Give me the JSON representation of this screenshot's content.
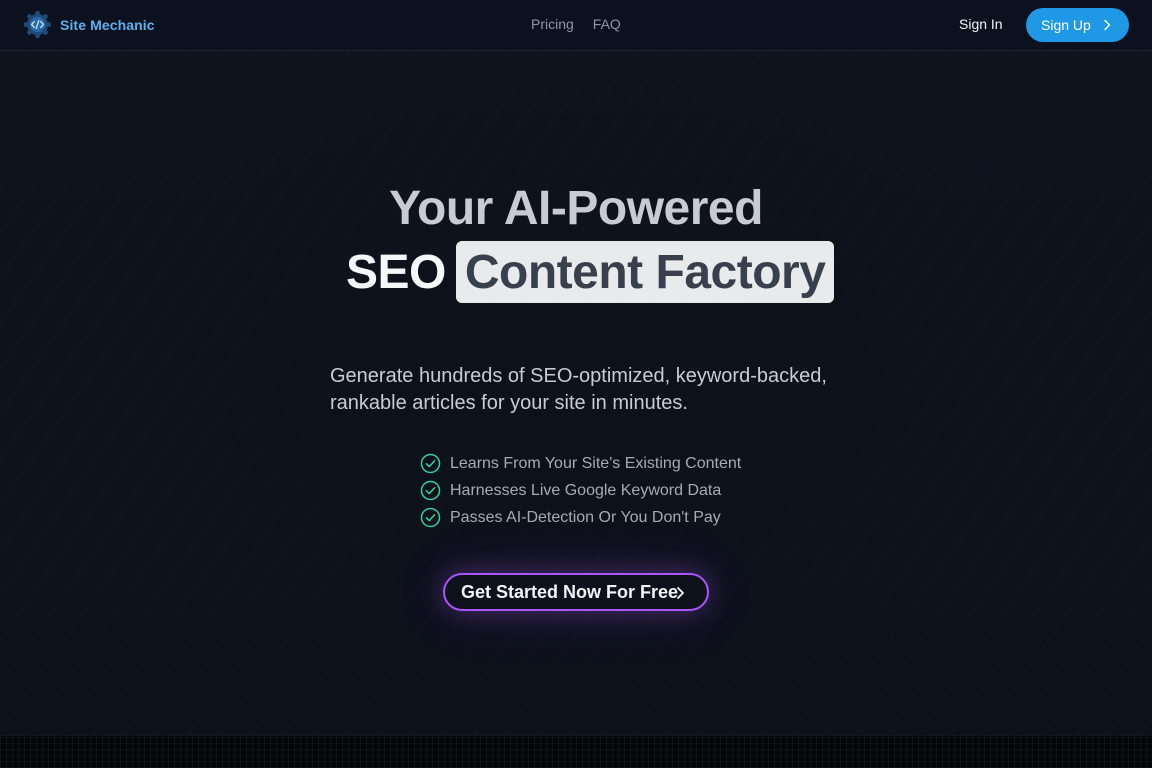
{
  "header": {
    "brand": "Site Mechanic",
    "nav": [
      "Pricing",
      "FAQ"
    ],
    "sign_in": "Sign In",
    "sign_up": "Sign Up"
  },
  "hero": {
    "title_line1": "Your AI-Powered",
    "title_line2_plain": "SEO",
    "title_line2_highlight": "Content Factory",
    "subtitle": "Generate hundreds of SEO-optimized, keyword-backed, rankable articles for your site in minutes.",
    "features": [
      "Learns From Your Site's Existing Content",
      "Harnesses Live Google Keyword Data",
      "Passes AI-Detection Or You Don't Pay"
    ],
    "cta": "Get Started Now For Free"
  },
  "icons": {
    "logo": "gear-code-icon",
    "feature": "check-circle-icon",
    "chevron": "chevron-right-icon"
  },
  "colors": {
    "background": "#0d111b",
    "brand": "#5bb1ee",
    "sign_up_button": "#1f98e6",
    "cta_border": "#a855f7",
    "check": "#34d399",
    "highlight_bg": "#e9eaec"
  }
}
